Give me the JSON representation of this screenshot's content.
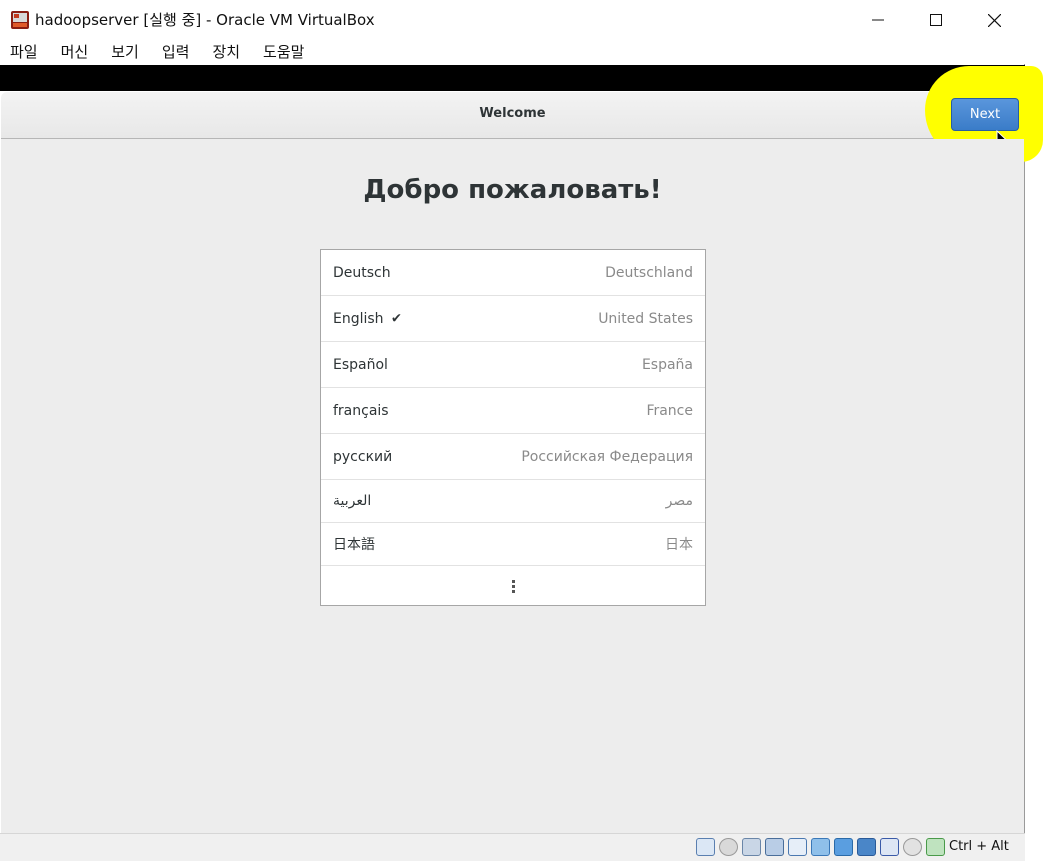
{
  "window": {
    "title": "hadoopserver [실행 중] - Oracle VM VirtualBox"
  },
  "menubar": {
    "items": [
      "파일",
      "머신",
      "보기",
      "입력",
      "장치",
      "도움말"
    ]
  },
  "header": {
    "title": "Welcome",
    "next_label": "Next"
  },
  "main": {
    "heading": "Добро пожаловать!",
    "languages": [
      {
        "name": "Deutsch",
        "region": "Deutschland",
        "selected": false
      },
      {
        "name": "English",
        "region": "United States",
        "selected": true,
        "check": "✔"
      },
      {
        "name": "Español",
        "region": "España",
        "selected": false
      },
      {
        "name": "français",
        "region": "France",
        "selected": false
      },
      {
        "name": "русский",
        "region": "Российская Федерация",
        "selected": false
      },
      {
        "name": "العربية",
        "region": "مصر",
        "selected": false
      },
      {
        "name": "日本語",
        "region": "日本",
        "selected": false
      }
    ]
  },
  "statusbar": {
    "host_key": "Ctrl + Alt",
    "icons": [
      "hard-disk-icon",
      "optical-drive-icon",
      "audio-icon",
      "network-icon",
      "usb-icon",
      "shared-folders-icon",
      "display-icon",
      "video-capture-icon",
      "cpu-icon",
      "mouse-integration-icon",
      "keyboard-icon"
    ]
  },
  "colors": {
    "accent": "#3a7cc8",
    "highlight": "#ffff00",
    "content_bg": "#ededed"
  }
}
